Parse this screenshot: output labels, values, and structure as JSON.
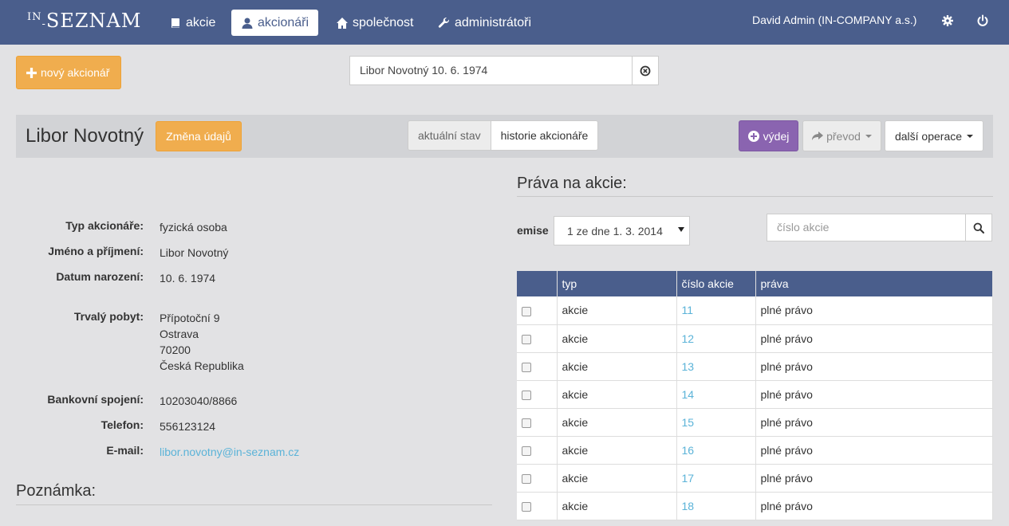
{
  "navbar": {
    "logo_small": "IN",
    "logo_main": "SEZNAM",
    "items": [
      {
        "label": "akcie",
        "icon": "book-icon"
      },
      {
        "label": "akcionáři",
        "icon": "user-icon"
      },
      {
        "label": "společnost",
        "icon": "home-icon"
      },
      {
        "label": "administrátoři",
        "icon": "wrench-icon"
      }
    ],
    "user": "David Admin (IN-COMPANY a.s.)",
    "colors": {
      "bar": "#4a5e8c",
      "accent": "#f0ad4e",
      "purple": "#8a64b0",
      "link": "#5bb3d8"
    }
  },
  "toolbar": {
    "new_label": "nový akcionář",
    "search_value": "Libor Novotný 10. 6. 1974"
  },
  "header": {
    "name": "Libor Novotný",
    "change_label": "Změna údajů",
    "tabs": [
      "aktuální stav",
      "historie akcionáře"
    ],
    "vydej_label": "výdej",
    "prevod_label": "převod",
    "dalsi_label": "další operace"
  },
  "details": {
    "typ_label": "Typ akcionáře:",
    "typ_value": "fyzická osoba",
    "jmeno_label": "Jméno a příjmení:",
    "jmeno_value": "Libor Novotný",
    "datum_label": "Datum narození:",
    "datum_value": "10. 6. 1974",
    "pobyt_label": "Trvalý pobyt:",
    "pobyt_lines": [
      "Přípotoční 9",
      "Ostrava",
      "70200",
      "Česká Republika"
    ],
    "banka_label": "Bankovní spojení:",
    "banka_value": "10203040/8866",
    "telefon_label": "Telefon:",
    "telefon_value": "556123124",
    "email_label": "E-mail:",
    "email_value": "libor.novotny@in-seznam.cz"
  },
  "note": {
    "title": "Poznámka:"
  },
  "rights": {
    "title": "Práva na akcie:",
    "emise_label": "emise",
    "emise_value": "1 ze dne 1. 3. 2014",
    "search_placeholder": "číslo akcie",
    "columns": [
      "typ",
      "číslo akcie",
      "práva"
    ],
    "rows": [
      {
        "typ": "akcie",
        "cislo": "11",
        "prava": "plné právo"
      },
      {
        "typ": "akcie",
        "cislo": "12",
        "prava": "plné právo"
      },
      {
        "typ": "akcie",
        "cislo": "13",
        "prava": "plné právo"
      },
      {
        "typ": "akcie",
        "cislo": "14",
        "prava": "plné právo"
      },
      {
        "typ": "akcie",
        "cislo": "15",
        "prava": "plné právo"
      },
      {
        "typ": "akcie",
        "cislo": "16",
        "prava": "plné právo"
      },
      {
        "typ": "akcie",
        "cislo": "17",
        "prava": "plné právo"
      },
      {
        "typ": "akcie",
        "cislo": "18",
        "prava": "plné právo"
      }
    ]
  }
}
